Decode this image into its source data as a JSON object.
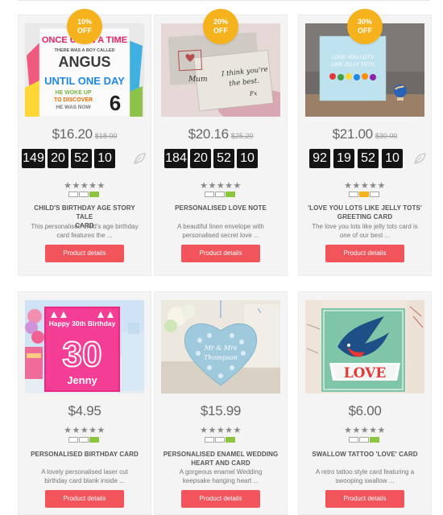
{
  "products": [
    {
      "badge_pct": "10%",
      "badge_off": "OFF",
      "price": "$16.20",
      "old_price": "$18.00",
      "countdown": [
        "149",
        "20",
        "52",
        "10"
      ],
      "stars": "★★★★★",
      "title_1": "CHILD'S BIRTHDAY AGE STORY TALE",
      "title_2": "CARD",
      "desc_1": "This personalised child's age birthday",
      "desc_2": "card features the ...",
      "button": "Product details",
      "card_text": [
        "ONCE UPON A TIME",
        "THERE WAS A BOY CALLED",
        "ANGUS",
        "UNTIL ONE DAY",
        "HE WOKE UP",
        "TO DISCOVER",
        "HE WAS NOW",
        "6"
      ],
      "rating_fill": [
        "empty",
        "empty",
        "green"
      ]
    },
    {
      "badge_pct": "20%",
      "badge_off": "OFF",
      "price": "$20.16",
      "old_price": "$25.20",
      "countdown": [
        "184",
        "20",
        "52",
        "10"
      ],
      "stars": "★★★★★",
      "title_1": "PERSONALISED LOVE NOTE",
      "title_2": "",
      "desc_1": "A beautiful linen envelope with",
      "desc_2": "personalised secret love ...",
      "button": "Product details",
      "card_text": [
        "Mum",
        "I think you're",
        "the best.",
        "Fx"
      ],
      "rating_fill": [
        "empty",
        "empty",
        "green"
      ]
    },
    {
      "badge_pct": "30%",
      "badge_off": "OFF",
      "price": "$21.00",
      "old_price": "$30.00",
      "countdown": [
        "92",
        "19",
        "52",
        "10"
      ],
      "stars": "★★★★★",
      "title_1": "'LOVE YOU LOTS LIKE JELLY TOTS'",
      "title_2": "GREETING CARD",
      "desc_1": "The love you lots like jelly tots card is",
      "desc_2": "one of our best ...",
      "button": "Product details",
      "card_text": [
        "LOVE YOU LOTS",
        "LIKE JELLY TOTS"
      ],
      "rating_fill": [
        "empty",
        "orange",
        "empty"
      ]
    },
    {
      "price": "$4.95",
      "stars": "★★★★★",
      "title_1": "PERSONALISED BIRTHDAY CARD",
      "title_2": "",
      "desc_1": "A lovely personalised laser cut",
      "desc_2": "birthday card blank inside ...",
      "button": "Product details",
      "card_text": [
        "Happy 30th Birthday",
        "30",
        "Jenny"
      ],
      "rating_fill": [
        "empty",
        "empty",
        "green"
      ]
    },
    {
      "price": "$15.99",
      "stars": "★★★★★",
      "title_1": "PERSONALISED ENAMEL WEDDING",
      "title_2": "HEART AND CARD",
      "desc_1": "A gorgeous enamel Wedding",
      "desc_2": "keepsake hanging heart ...",
      "button": "Product details",
      "card_text": [
        "Mr & Mrs",
        "Thompson"
      ],
      "rating_fill": [
        "empty",
        "empty",
        "green"
      ]
    },
    {
      "price": "$6.00",
      "stars": "★★★★★",
      "title_1": "SWALLOW TATTOO 'LOVE' CARD",
      "title_2": "",
      "desc_1": "A retro tattoo style card featuring a",
      "desc_2": "swooping swallow ...",
      "button": "Product details",
      "card_text": [
        "LOVE"
      ],
      "rating_fill": [
        "empty",
        "empty",
        "green"
      ]
    }
  ],
  "colors": {
    "badge": "#f6b21c",
    "button": "#f2545b",
    "rating_green": "#8cc63f",
    "rating_orange": "#f6b21c",
    "countdown_bg": "#141414"
  }
}
